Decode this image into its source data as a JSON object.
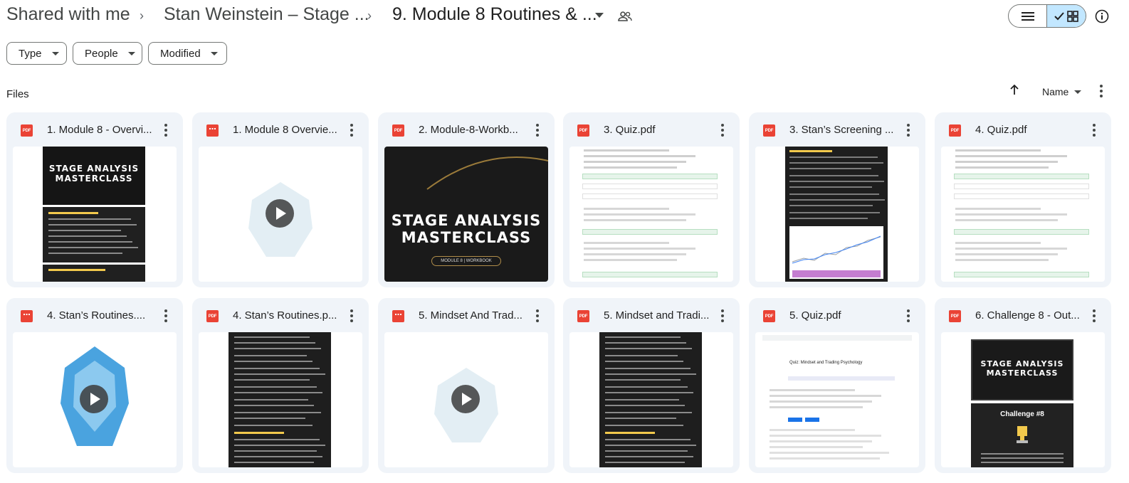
{
  "breadcrumb": {
    "root": "Shared with me",
    "parent": "Stan Weinstein – Stage ...",
    "current": "9. Module 8 Routines & ..."
  },
  "filters": {
    "type": "Type",
    "people": "People",
    "modified": "Modified"
  },
  "section": {
    "label": "Files",
    "sort_label": "Name"
  },
  "files": [
    {
      "name": "1. Module 8 - Overvi...",
      "kind": "pdf",
      "thumb": "slides"
    },
    {
      "name": "1. Module 8 Overvie...",
      "kind": "video",
      "thumb": "video-faded"
    },
    {
      "name": "2. Module-8-Workb...",
      "kind": "pdf",
      "thumb": "workbook"
    },
    {
      "name": "3. Quiz.pdf",
      "kind": "pdf",
      "thumb": "quiz"
    },
    {
      "name": "3. Stan’s Screening ...",
      "kind": "pdf",
      "thumb": "dark-doc-chart"
    },
    {
      "name": "4. Quiz.pdf",
      "kind": "pdf",
      "thumb": "quiz"
    },
    {
      "name": "4. Stan’s Routines....",
      "kind": "video",
      "thumb": "video-lion"
    },
    {
      "name": "4. Stan’s Routines.p...",
      "kind": "pdf",
      "thumb": "dark-doc"
    },
    {
      "name": "5. Mindset And Trad...",
      "kind": "video",
      "thumb": "video-faded"
    },
    {
      "name": "5. Mindset and Tradi...",
      "kind": "pdf",
      "thumb": "dark-doc"
    },
    {
      "name": "5. Quiz.pdf",
      "kind": "pdf",
      "thumb": "quiz-form"
    },
    {
      "name": "6. Challenge 8 - Out...",
      "kind": "pdf",
      "thumb": "challenge"
    }
  ],
  "thumb_text": {
    "masterclass_line1": "STAGE ANALYSIS",
    "masterclass_line2": "MASTERCLASS",
    "workbook_badge": "MODULE 8 | WORKBOOK",
    "challenge": "Challenge #8",
    "quiz_form_title": "Quiz: Mindset and Trading Psychology"
  },
  "colors": {
    "pdf_red": "#ea4335",
    "selected_toggle": "#c2e7ff",
    "card_bg": "#f0f4f9",
    "accent_yellow": "#f2c94c"
  }
}
